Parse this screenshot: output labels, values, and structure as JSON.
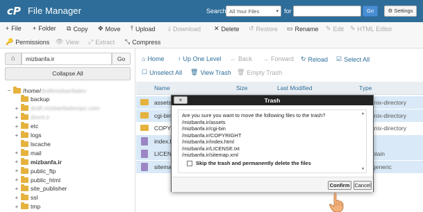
{
  "header": {
    "app_name": "File Manager",
    "search_label": "Search",
    "search_scope": "All Your Files",
    "for_label": "for",
    "search_value": "",
    "go_label": "Go",
    "settings_label": "Settings",
    "bg_color": "#2e6d99"
  },
  "toolbar": {
    "row1": [
      {
        "icon": "+",
        "label": "File",
        "enabled": true
      },
      {
        "icon": "+",
        "label": "Folder",
        "enabled": true
      },
      {
        "icon": "⧉",
        "label": "Copy",
        "enabled": true
      },
      {
        "icon": "✥",
        "label": "Move",
        "enabled": true
      },
      {
        "icon": "⤒",
        "label": "Upload",
        "enabled": true
      },
      {
        "icon": "⤓",
        "label": "Download",
        "enabled": false
      },
      {
        "icon": "✕",
        "label": "Delete",
        "enabled": true
      },
      {
        "icon": "↺",
        "label": "Restore",
        "enabled": false
      },
      {
        "icon": "▭",
        "label": "Rename",
        "enabled": true
      },
      {
        "icon": "✎",
        "label": "Edit",
        "enabled": false
      },
      {
        "icon": "✎",
        "label": "HTML Editor",
        "enabled": false
      }
    ],
    "row2": [
      {
        "icon": "🔑",
        "label": "Permissions",
        "enabled": true
      },
      {
        "icon": "👁",
        "label": "View",
        "enabled": false
      },
      {
        "icon": "⤢",
        "label": "Extract",
        "enabled": false
      },
      {
        "icon": "⤡",
        "label": "Compress",
        "enabled": true
      }
    ]
  },
  "left": {
    "path_value": "mizbanfa.ir",
    "go_label": "Go",
    "collapse_label": "Collapse All",
    "tree": [
      {
        "toggle": "−",
        "label": "/home/",
        "suffix": "draftmizbanfadev",
        "level": 0,
        "bold": false
      },
      {
        "toggle": "",
        "label": "backup",
        "level": 1,
        "bold": false
      },
      {
        "toggle": "+",
        "label": "",
        "suffix": "draft.mizbanfadevopc.com",
        "level": 1,
        "bold": false
      },
      {
        "toggle": "+",
        "label": "",
        "suffix": "dzvnt.ir",
        "level": 1,
        "bold": false
      },
      {
        "toggle": "+",
        "label": "etc",
        "level": 1,
        "bold": false
      },
      {
        "toggle": "+",
        "label": "logs",
        "level": 1,
        "bold": false
      },
      {
        "toggle": "",
        "label": "lscache",
        "level": 1,
        "bold": false
      },
      {
        "toggle": "+",
        "label": "mail",
        "level": 1,
        "bold": false
      },
      {
        "toggle": "+",
        "label": "mizbanfa.ir",
        "level": 1,
        "bold": true
      },
      {
        "toggle": "+",
        "label": "public_ftp",
        "level": 1,
        "bold": false
      },
      {
        "toggle": "+",
        "label": "public_html",
        "level": 1,
        "bold": false
      },
      {
        "toggle": "+",
        "label": "site_publisher",
        "level": 1,
        "bold": false
      },
      {
        "toggle": "+",
        "label": "ssl",
        "level": 1,
        "bold": false
      },
      {
        "toggle": "+",
        "label": "tmp",
        "level": 1,
        "bold": false
      }
    ]
  },
  "actions": {
    "row1": [
      {
        "icon": "⌂",
        "label": "Home",
        "enabled": true
      },
      {
        "icon": "↑",
        "label": "Up One Level",
        "enabled": true
      },
      {
        "icon": "←",
        "label": "Back",
        "enabled": false
      },
      {
        "icon": "→",
        "label": "Forward",
        "enabled": false
      },
      {
        "icon": "↻",
        "label": "Reload",
        "enabled": true
      },
      {
        "icon": "☑",
        "label": "Select All",
        "enabled": true
      }
    ],
    "row2": [
      {
        "icon": "☐",
        "label": "Unselect All",
        "enabled": true
      },
      {
        "icon": "🗑",
        "label": "View Trash",
        "enabled": true
      },
      {
        "icon": "🗑",
        "label": "Empty Trash",
        "enabled": false
      }
    ]
  },
  "table": {
    "headers": {
      "name": "Name",
      "size": "Size",
      "modified": "Last Modified",
      "type": "Type"
    },
    "rows": [
      {
        "name": "assets",
        "kind": "folder",
        "type": "unix-directory",
        "selected": true
      },
      {
        "name": "cgi-bin",
        "kind": "folder",
        "type": "unix-directory",
        "selected": true
      },
      {
        "name": "COPYRIGHT",
        "kind": "folder",
        "type": "unix-directory",
        "selected": false
      },
      {
        "name": "index.html",
        "kind": "file",
        "type": "",
        "selected": true
      },
      {
        "name": "LICENSE.txt",
        "kind": "file",
        "type": "plain",
        "selected": true
      },
      {
        "name": "sitemap.xml",
        "kind": "file",
        "type": "generic",
        "selected": true
      }
    ]
  },
  "modal": {
    "title": "Trash",
    "close_label": "×",
    "prompt": "Are you sure you want to move the following files to the trash?",
    "files": [
      "/mizbanfa.ir/assets",
      "/mizbanfa.ir/cgi-bin",
      "/mizbanfa.ir/COPYRIGHT",
      "/mizbanfa.ir/index.html",
      "/mizbanfa.ir/LICENSE.txt",
      "/mizbanfa.ir/sitemap.xml"
    ],
    "skip_label": "Skip the trash and permanently delete the files",
    "confirm_label": "Confirm",
    "cancel_label": "Cancel"
  }
}
